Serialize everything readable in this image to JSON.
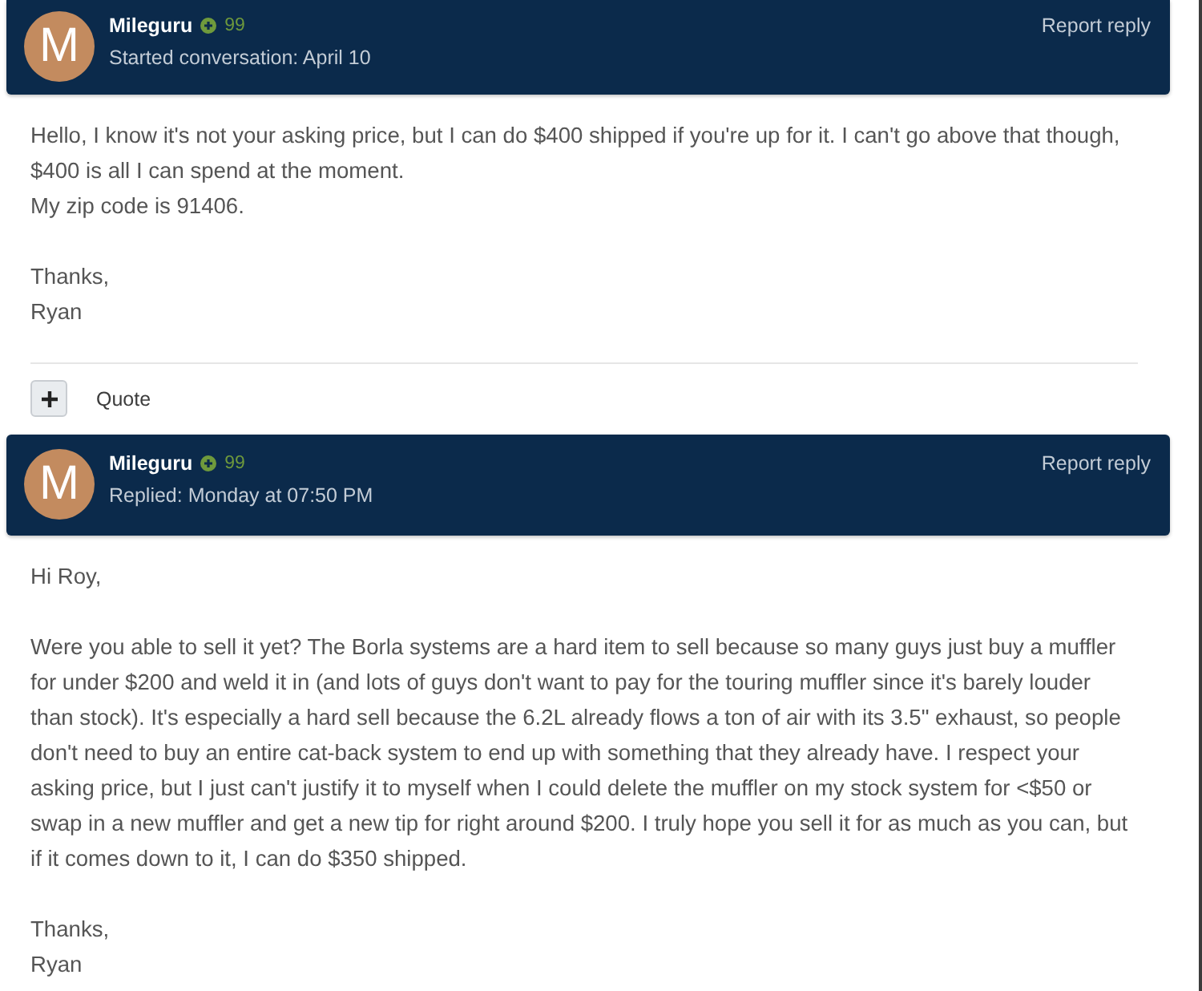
{
  "messages": [
    {
      "author": {
        "initial": "M",
        "name": "Mileguru",
        "reputation": "99"
      },
      "meta": "Started conversation: April 10",
      "report_label": "Report reply",
      "body": [
        [
          "Hello, I know it's not your asking price, but I can do $400 shipped if you're up for it. I can't go above that though, $400 is all I can spend at the moment.",
          "My zip code is 91406."
        ],
        [
          "Thanks,",
          "Ryan"
        ]
      ],
      "actions": {
        "quote_label": "Quote"
      }
    },
    {
      "author": {
        "initial": "M",
        "name": "Mileguru",
        "reputation": "99"
      },
      "meta": "Replied: Monday at 07:50 PM",
      "report_label": "Report reply",
      "body": [
        [
          "Hi Roy,"
        ],
        [
          "Were you able to sell it yet? The Borla systems are a hard item to sell because so many guys just buy a muffler for under $200 and weld it in (and lots of guys don't want to pay for the touring muffler since it's barely louder than stock). It's especially a hard sell because the 6.2L already flows a ton of air with its 3.5\" exhaust, so people don't need to buy an entire cat-back system to end up with something that they already have. I respect your asking price, but I just can't justify it to myself when I could delete the muffler on my stock system for <$50 or swap in a new muffler and get a new tip for right around $200. I truly hope you sell it for as much as you can, but if it comes down to it, I can do $350 shipped."
        ],
        [
          "Thanks,",
          "Ryan"
        ]
      ]
    }
  ]
}
